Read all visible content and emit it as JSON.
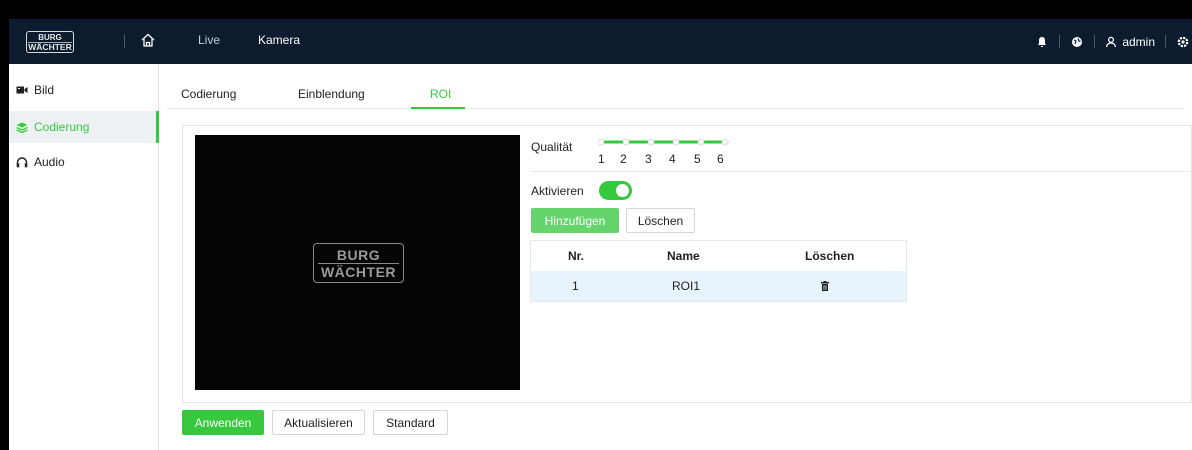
{
  "brand": {
    "logo_line1": "BURG",
    "logo_line2": "WÄCHTER"
  },
  "nav": {
    "live": "Live",
    "kamera": "Kamera",
    "user": "admin"
  },
  "sidebar": {
    "items": [
      {
        "label": "Bild",
        "icon": "camera-icon"
      },
      {
        "label": "Codierung",
        "icon": "layers-icon",
        "active": true
      },
      {
        "label": "Audio",
        "icon": "headphones-icon"
      }
    ]
  },
  "tabs": [
    {
      "label": "Codierung"
    },
    {
      "label": "Einblendung"
    },
    {
      "label": "ROI",
      "active": true
    }
  ],
  "video": {
    "logo_line1": "BURG",
    "logo_line2": "WÄCHTER"
  },
  "quality": {
    "label": "Qualität",
    "levels": [
      "1",
      "2",
      "3",
      "4",
      "5",
      "6"
    ]
  },
  "activate": {
    "label": "Aktivieren",
    "enabled": true
  },
  "buttons": {
    "add": "Hinzufügen",
    "delete": "Löschen"
  },
  "table": {
    "headers": {
      "nr": "Nr.",
      "name": "Name",
      "delete": "Löschen"
    },
    "rows": [
      {
        "nr": "1",
        "name": "ROI1"
      }
    ]
  },
  "footer": {
    "apply": "Anwenden",
    "refresh": "Aktualisieren",
    "standard": "Standard"
  },
  "colors": {
    "accent": "#36c93e",
    "navbar": "#0c1c2e",
    "selected_row": "#e8f4fc"
  }
}
